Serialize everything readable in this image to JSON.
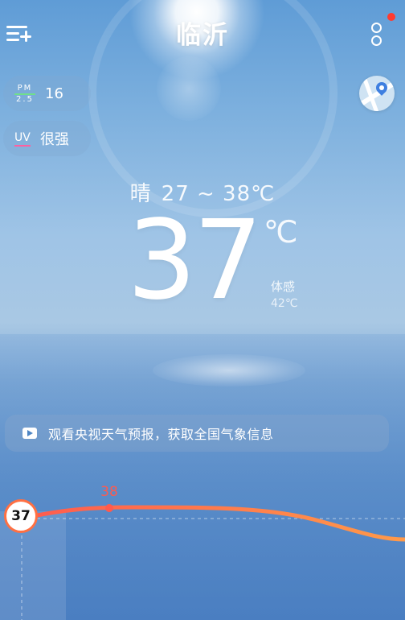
{
  "header": {
    "city": "临沂",
    "menu_icon": "add-city-menu-icon",
    "more_icon": "more-options-icon",
    "notification_color": "#ff3b30"
  },
  "air": {
    "pm_top": "PM",
    "pm_bottom": "2.5",
    "pm_value": "16",
    "uv_label": "UV",
    "uv_value": "很强"
  },
  "map_button": {
    "icon": "map-pin-icon"
  },
  "current": {
    "condition": "晴",
    "range": "27 ~ 38℃",
    "temperature": "37",
    "unit": "℃",
    "feels_label": "体感",
    "feels_value": "42℃"
  },
  "banner": {
    "icon": "play-video-icon",
    "text": "观看央视天气预报，获取全国气象信息"
  },
  "hourly": {
    "current_badge": "37",
    "peak_label": "38",
    "curve_color_start": "#ff5a4e",
    "curve_color_end": "#ff9a4a"
  }
}
